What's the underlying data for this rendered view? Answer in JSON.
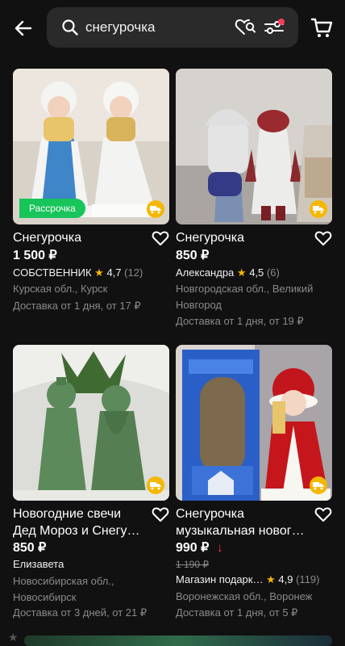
{
  "search": {
    "query": "снегурочка"
  },
  "products": [
    {
      "title": "Снегурочка",
      "price": "1 500 ₽",
      "badge": "Рассрочка",
      "seller": "СОБСТВЕННИК",
      "rating": "4,7",
      "reviews": "(12)",
      "location": "Курская обл., Курск",
      "delivery": "Доставка от 1 дня, от 17 ₽"
    },
    {
      "title": "Снегурочка",
      "price": "850 ₽",
      "seller": "Александра",
      "rating": "4,5",
      "reviews": "(6)",
      "location": "Новгородская обл., Великий Новгород",
      "delivery": "Доставка от 1 дня, от 19 ₽"
    },
    {
      "title": "Новогодние свечи Дед Мороз и Снегу…",
      "price": "850 ₽",
      "seller": "Елизавета",
      "location": "Новосибирская обл., Новосибирск",
      "delivery": "Доставка от 3 дней, от 21 ₽"
    },
    {
      "title": "Снегурочка музыкальная новог…",
      "price": "990 ₽",
      "old_price": "1 190 ₽",
      "seller": "Магазин подарк…",
      "rating": "4,9",
      "reviews": "(119)",
      "location": "Воронежская обл., Воронеж",
      "delivery": "Доставка от 1 дня, от 5 ₽"
    }
  ],
  "colors": {
    "background": "#111111",
    "search_bg": "#2a2a2a",
    "installment_badge": "#17c55a",
    "delivery_badge": "#f5b700",
    "star": "#f5b700",
    "price_drop": "#ff3b3b",
    "muted_text": "#8a8a8a"
  },
  "icons": [
    "back-arrow-icon",
    "search-icon",
    "favorite-search-icon",
    "filter-icon",
    "cart-icon",
    "heart-icon",
    "delivery-truck-icon",
    "star-icon"
  ]
}
